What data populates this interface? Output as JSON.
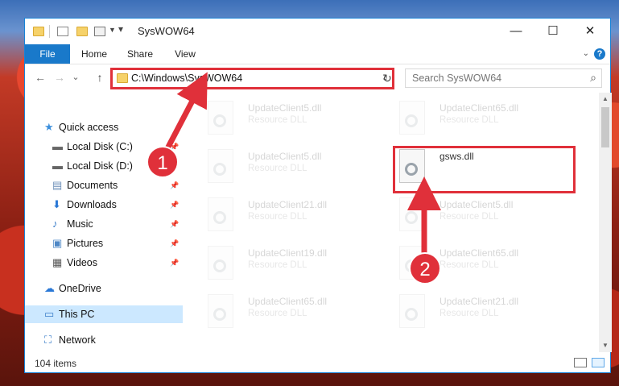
{
  "window": {
    "title": "SysWOW64",
    "controls": {
      "minimize": "—",
      "maximize": "☐",
      "close": "✕"
    }
  },
  "ribbon": {
    "tabs": [
      "File",
      "Home",
      "Share",
      "View"
    ],
    "help": "?"
  },
  "navigation": {
    "back": "←",
    "forward": "→",
    "recent": "⌄",
    "up": "↑",
    "address": "C:\\Windows\\SysWOW64",
    "search_placeholder": "Search SysWOW64"
  },
  "sidebar": {
    "items": [
      {
        "label": "Quick access",
        "icon": "star-icon",
        "pinned": false
      },
      {
        "label": "Local Disk (C:)",
        "icon": "drive-icon",
        "pinned": true
      },
      {
        "label": "Local Disk (D:)",
        "icon": "drive-icon",
        "pinned": true
      },
      {
        "label": "Documents",
        "icon": "documents-icon",
        "pinned": true
      },
      {
        "label": "Downloads",
        "icon": "download-icon",
        "pinned": true
      },
      {
        "label": "Music",
        "icon": "music-icon",
        "pinned": true
      },
      {
        "label": "Pictures",
        "icon": "pictures-icon",
        "pinned": true
      },
      {
        "label": "Videos",
        "icon": "videos-icon",
        "pinned": true
      },
      {
        "label": "OneDrive",
        "icon": "cloud-icon",
        "pinned": false
      },
      {
        "label": "This PC",
        "icon": "computer-icon",
        "pinned": false,
        "selected": true
      },
      {
        "label": "Network",
        "icon": "network-icon",
        "pinned": false
      }
    ]
  },
  "files": [
    {
      "name": "UpdateClient5.dll",
      "type": "Resource DLL",
      "faded": true
    },
    {
      "name": "UpdateClient65.dll",
      "type": "Resource DLL",
      "faded": true
    },
    {
      "name": "UpdateClient5.dll",
      "type": "Resource DLL",
      "faded": true
    },
    {
      "name": "gsws.dll",
      "type": "",
      "faded": false,
      "highlighted": true
    },
    {
      "name": "UpdateClient21.dll",
      "type": "Resource DLL",
      "faded": true
    },
    {
      "name": "UpdateClient5.dll",
      "type": "Resource DLL",
      "faded": true
    },
    {
      "name": "UpdateClient19.dll",
      "type": "Resource DLL",
      "faded": true
    },
    {
      "name": "UpdateClient65.dll",
      "type": "Resource DLL",
      "faded": true
    },
    {
      "name": "UpdateClient65.dll",
      "type": "Resource DLL",
      "faded": true
    },
    {
      "name": "UpdateClient21.dll",
      "type": "Resource DLL",
      "faded": true
    }
  ],
  "status": {
    "item_count": "104 items"
  },
  "annotations": {
    "callout_1": "1",
    "callout_2": "2",
    "color": "#e0303a"
  }
}
